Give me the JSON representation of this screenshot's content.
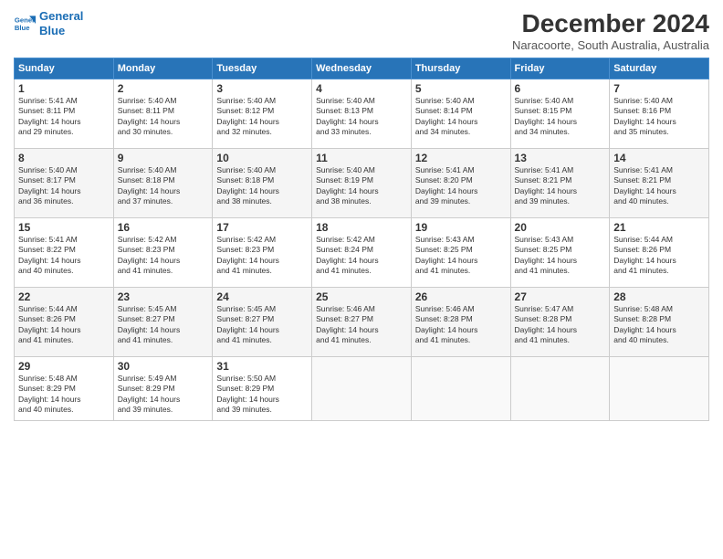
{
  "logo": {
    "line1": "General",
    "line2": "Blue"
  },
  "title": "December 2024",
  "subtitle": "Naracoorte, South Australia, Australia",
  "days_header": [
    "Sunday",
    "Monday",
    "Tuesday",
    "Wednesday",
    "Thursday",
    "Friday",
    "Saturday"
  ],
  "weeks": [
    [
      {
        "day": "1",
        "info": "Sunrise: 5:41 AM\nSunset: 8:11 PM\nDaylight: 14 hours\nand 29 minutes."
      },
      {
        "day": "2",
        "info": "Sunrise: 5:40 AM\nSunset: 8:11 PM\nDaylight: 14 hours\nand 30 minutes."
      },
      {
        "day": "3",
        "info": "Sunrise: 5:40 AM\nSunset: 8:12 PM\nDaylight: 14 hours\nand 32 minutes."
      },
      {
        "day": "4",
        "info": "Sunrise: 5:40 AM\nSunset: 8:13 PM\nDaylight: 14 hours\nand 33 minutes."
      },
      {
        "day": "5",
        "info": "Sunrise: 5:40 AM\nSunset: 8:14 PM\nDaylight: 14 hours\nand 34 minutes."
      },
      {
        "day": "6",
        "info": "Sunrise: 5:40 AM\nSunset: 8:15 PM\nDaylight: 14 hours\nand 34 minutes."
      },
      {
        "day": "7",
        "info": "Sunrise: 5:40 AM\nSunset: 8:16 PM\nDaylight: 14 hours\nand 35 minutes."
      }
    ],
    [
      {
        "day": "8",
        "info": "Sunrise: 5:40 AM\nSunset: 8:17 PM\nDaylight: 14 hours\nand 36 minutes."
      },
      {
        "day": "9",
        "info": "Sunrise: 5:40 AM\nSunset: 8:18 PM\nDaylight: 14 hours\nand 37 minutes."
      },
      {
        "day": "10",
        "info": "Sunrise: 5:40 AM\nSunset: 8:18 PM\nDaylight: 14 hours\nand 38 minutes."
      },
      {
        "day": "11",
        "info": "Sunrise: 5:40 AM\nSunset: 8:19 PM\nDaylight: 14 hours\nand 38 minutes."
      },
      {
        "day": "12",
        "info": "Sunrise: 5:41 AM\nSunset: 8:20 PM\nDaylight: 14 hours\nand 39 minutes."
      },
      {
        "day": "13",
        "info": "Sunrise: 5:41 AM\nSunset: 8:21 PM\nDaylight: 14 hours\nand 39 minutes."
      },
      {
        "day": "14",
        "info": "Sunrise: 5:41 AM\nSunset: 8:21 PM\nDaylight: 14 hours\nand 40 minutes."
      }
    ],
    [
      {
        "day": "15",
        "info": "Sunrise: 5:41 AM\nSunset: 8:22 PM\nDaylight: 14 hours\nand 40 minutes."
      },
      {
        "day": "16",
        "info": "Sunrise: 5:42 AM\nSunset: 8:23 PM\nDaylight: 14 hours\nand 41 minutes."
      },
      {
        "day": "17",
        "info": "Sunrise: 5:42 AM\nSunset: 8:23 PM\nDaylight: 14 hours\nand 41 minutes."
      },
      {
        "day": "18",
        "info": "Sunrise: 5:42 AM\nSunset: 8:24 PM\nDaylight: 14 hours\nand 41 minutes."
      },
      {
        "day": "19",
        "info": "Sunrise: 5:43 AM\nSunset: 8:25 PM\nDaylight: 14 hours\nand 41 minutes."
      },
      {
        "day": "20",
        "info": "Sunrise: 5:43 AM\nSunset: 8:25 PM\nDaylight: 14 hours\nand 41 minutes."
      },
      {
        "day": "21",
        "info": "Sunrise: 5:44 AM\nSunset: 8:26 PM\nDaylight: 14 hours\nand 41 minutes."
      }
    ],
    [
      {
        "day": "22",
        "info": "Sunrise: 5:44 AM\nSunset: 8:26 PM\nDaylight: 14 hours\nand 41 minutes."
      },
      {
        "day": "23",
        "info": "Sunrise: 5:45 AM\nSunset: 8:27 PM\nDaylight: 14 hours\nand 41 minutes."
      },
      {
        "day": "24",
        "info": "Sunrise: 5:45 AM\nSunset: 8:27 PM\nDaylight: 14 hours\nand 41 minutes."
      },
      {
        "day": "25",
        "info": "Sunrise: 5:46 AM\nSunset: 8:27 PM\nDaylight: 14 hours\nand 41 minutes."
      },
      {
        "day": "26",
        "info": "Sunrise: 5:46 AM\nSunset: 8:28 PM\nDaylight: 14 hours\nand 41 minutes."
      },
      {
        "day": "27",
        "info": "Sunrise: 5:47 AM\nSunset: 8:28 PM\nDaylight: 14 hours\nand 41 minutes."
      },
      {
        "day": "28",
        "info": "Sunrise: 5:48 AM\nSunset: 8:28 PM\nDaylight: 14 hours\nand 40 minutes."
      }
    ],
    [
      {
        "day": "29",
        "info": "Sunrise: 5:48 AM\nSunset: 8:29 PM\nDaylight: 14 hours\nand 40 minutes."
      },
      {
        "day": "30",
        "info": "Sunrise: 5:49 AM\nSunset: 8:29 PM\nDaylight: 14 hours\nand 39 minutes."
      },
      {
        "day": "31",
        "info": "Sunrise: 5:50 AM\nSunset: 8:29 PM\nDaylight: 14 hours\nand 39 minutes."
      },
      {
        "day": "",
        "info": ""
      },
      {
        "day": "",
        "info": ""
      },
      {
        "day": "",
        "info": ""
      },
      {
        "day": "",
        "info": ""
      }
    ]
  ]
}
